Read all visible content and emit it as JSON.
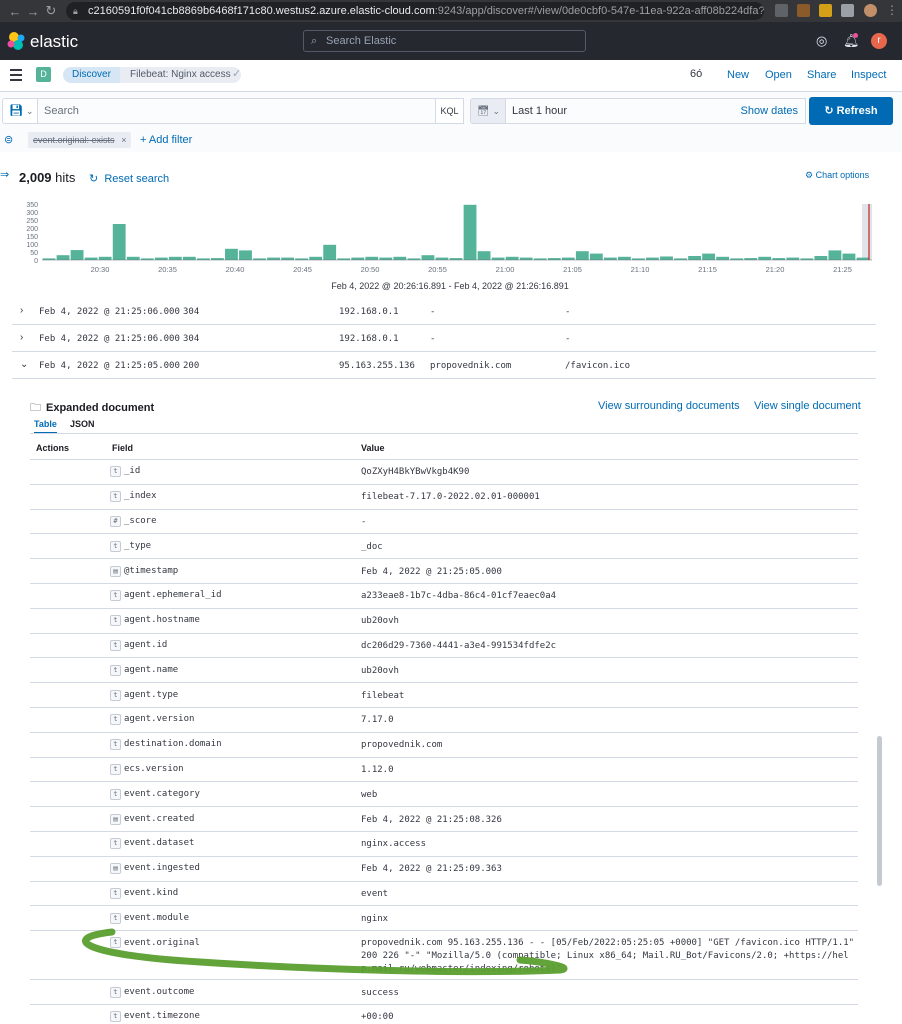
{
  "browser": {
    "url_main": "c2160591f0f041cb8869b6468f171c80.westus2.azure.elastic-cloud.com",
    "url_rest": ":9243/app/discover#/view/0de0cbf0-547e-11ea-922a-aff08b224dfa?_g...",
    "nav": [
      "←",
      "→",
      "↻"
    ]
  },
  "header": {
    "logo_text": "elastic",
    "search_placeholder": "Search Elastic",
    "avatar_letter": "r"
  },
  "breadcrumbs": {
    "space_letter": "D",
    "items": [
      "Discover",
      "Filebeat: Nginx access"
    ],
    "actions": [
      "New",
      "Open",
      "Share",
      "Inspect"
    ]
  },
  "query": {
    "placeholder": "Search",
    "language": "KQL",
    "date_range": "Last 1 hour",
    "show_dates": "Show dates",
    "refresh": "Refresh"
  },
  "filters": {
    "pill": "event.original: exists",
    "add": "+ Add filter"
  },
  "hits": {
    "count": "2,009",
    "label": "hits",
    "reset": "Reset search",
    "chart_options": "Chart options",
    "range": "Feb 4, 2022 @ 20:26:16.891 - Feb 4, 2022 @ 21:26:16.891"
  },
  "chart_data": {
    "type": "bar",
    "yticks": [
      350,
      300,
      250,
      200,
      150,
      100,
      50,
      0
    ],
    "ylim": [
      0,
      350
    ],
    "xticks": [
      "20:30",
      "20:35",
      "20:40",
      "20:45",
      "20:50",
      "20:55",
      "21:00",
      "21:05",
      "21:10",
      "21:15",
      "21:20",
      "21:25"
    ],
    "values": [
      10,
      30,
      62,
      15,
      20,
      225,
      20,
      10,
      15,
      20,
      20,
      10,
      12,
      70,
      60,
      10,
      15,
      15,
      10,
      20,
      95,
      10,
      15,
      20,
      15,
      20,
      10,
      30,
      15,
      12,
      345,
      55,
      15,
      20,
      15,
      10,
      12,
      15,
      55,
      40,
      15,
      20,
      10,
      15,
      22,
      10,
      25,
      40,
      20,
      10,
      12,
      20,
      12,
      15,
      10,
      25,
      60,
      40,
      15
    ],
    "bar_color": "#54b399",
    "highlight_color": "#bd271e"
  },
  "rows": [
    {
      "timestamp": "Feb 4, 2022 @ 21:25:06.000",
      "status": "304",
      "ip": "192.168.0.1",
      "domain": "-",
      "path": "-",
      "expanded": false
    },
    {
      "timestamp": "Feb 4, 2022 @ 21:25:06.000",
      "status": "304",
      "ip": "192.168.0.1",
      "domain": "-",
      "path": "-",
      "expanded": false
    },
    {
      "timestamp": "Feb 4, 2022 @ 21:25:05.000",
      "status": "200",
      "ip": "95.163.255.136",
      "domain": "propovednik.com",
      "path": "/favicon.ico",
      "expanded": true
    }
  ],
  "expanded": {
    "title": "Expanded document",
    "view_surrounding": "View surrounding documents",
    "view_single": "View single document",
    "tabs": [
      "Table",
      "JSON"
    ],
    "col_actions": "Actions",
    "col_field": "Field",
    "col_value": "Value",
    "fields": [
      {
        "type": "t",
        "name": "_id",
        "value": "QoZXyH4BkYBwVkgb4K90"
      },
      {
        "type": "t",
        "name": "_index",
        "value": "filebeat-7.17.0-2022.02.01-000001"
      },
      {
        "type": "#",
        "name": "_score",
        "value": " -"
      },
      {
        "type": "t",
        "name": "_type",
        "value": "_doc"
      },
      {
        "type": "d",
        "name": "@timestamp",
        "value": "Feb 4, 2022 @ 21:25:05.000"
      },
      {
        "type": "t",
        "name": "agent.ephemeral_id",
        "value": "a233eae8-1b7c-4dba-86c4-01cf7eaec0a4"
      },
      {
        "type": "t",
        "name": "agent.hostname",
        "value": "ub20ovh"
      },
      {
        "type": "t",
        "name": "agent.id",
        "value": "dc206d29-7360-4441-a3e4-991534fdfe2c"
      },
      {
        "type": "t",
        "name": "agent.name",
        "value": "ub20ovh"
      },
      {
        "type": "t",
        "name": "agent.type",
        "value": "filebeat"
      },
      {
        "type": "t",
        "name": "agent.version",
        "value": "7.17.0"
      },
      {
        "type": "t",
        "name": "destination.domain",
        "value": "propovednik.com"
      },
      {
        "type": "t",
        "name": "ecs.version",
        "value": "1.12.0"
      },
      {
        "type": "t",
        "name": "event.category",
        "value": "web"
      },
      {
        "type": "d",
        "name": "event.created",
        "value": "Feb 4, 2022 @ 21:25:08.326"
      },
      {
        "type": "t",
        "name": "event.dataset",
        "value": "nginx.access"
      },
      {
        "type": "d",
        "name": "event.ingested",
        "value": "Feb 4, 2022 @ 21:25:09.363"
      },
      {
        "type": "t",
        "name": "event.kind",
        "value": "event"
      },
      {
        "type": "t",
        "name": "event.module",
        "value": "nginx"
      },
      {
        "type": "t",
        "name": "event.original",
        "value": "propovednik.com 95.163.255.136 - - [05/Feb/2022:05:25:05 +0000] \"GET /favicon.ico HTTP/1.1\" 200 226 \"-\" \"Mozilla/5.0 (compatible; Linux x86_64; Mail.RU_Bot/Favicons/2.0; +https://help.mail.ru/webmaster/indexing/robots)\""
      },
      {
        "type": "t",
        "name": "event.outcome",
        "value": "success"
      },
      {
        "type": "t",
        "name": "event.timezone",
        "value": "+00:00"
      }
    ]
  }
}
